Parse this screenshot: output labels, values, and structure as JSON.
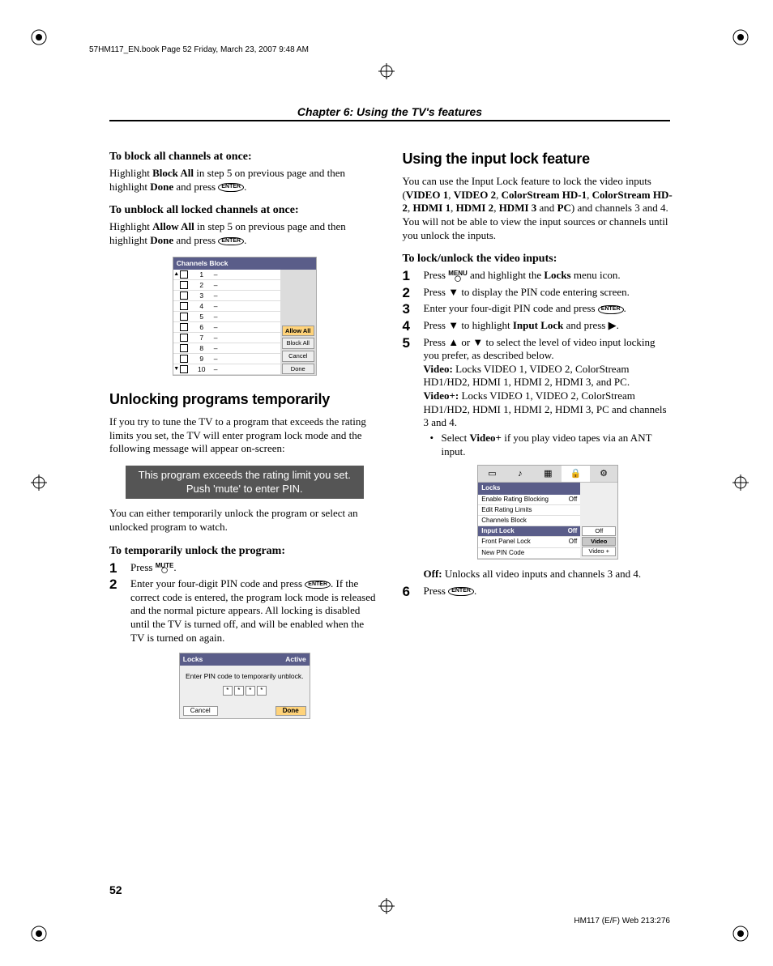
{
  "header_line": "57HM117_EN.book  Page 52  Friday, March 23, 2007  9:48 AM",
  "chapter_title": "Chapter 6: Using the TV's features",
  "page_number": "52",
  "footer_right": "HM117 (E/F) Web 213:276",
  "icons": {
    "enter": "ENTER",
    "menu": "MENU",
    "mute": "MUTE"
  },
  "left": {
    "block_all_h": "To block all channels at once:",
    "block_all_p1a": "Highlight ",
    "block_all_p1b": "Block All",
    "block_all_p1c": " in step 5 on previous page and then highlight ",
    "block_all_p1d": "Done",
    "block_all_p1e": " and press ",
    "block_all_p1f": ".",
    "unblock_h": "To unblock all locked channels at once:",
    "unblock_p1a": "Highlight ",
    "unblock_p1b": "Allow All",
    "unblock_p1c": " in step 5 on previous page and then highlight ",
    "unblock_p1d": "Done",
    "unblock_p1e": " and press ",
    "unblock_p1f": ".",
    "channels_title": "Channels Block",
    "channels_rows": [
      "1",
      "2",
      "3",
      "4",
      "5",
      "6",
      "7",
      "8",
      "9",
      "10"
    ],
    "channels_btns": [
      "Allow All",
      "Block All",
      "Cancel",
      "Done"
    ],
    "sect_unlock": "Unlocking programs temporarily",
    "unlock_intro": "If you try to tune the TV to a program that exceeds the rating limits you set, the TV will enter program lock mode and the following message will appear on-screen:",
    "msg1": "This program exceeds the rating limit you set.",
    "msg2": "Push 'mute' to enter PIN.",
    "unlock_after": "You can either temporarily unlock the program or select an unlocked program to watch.",
    "unlock_steps_h": "To temporarily unlock the program:",
    "step1a": "Press ",
    "step1b": ".",
    "step2a": "Enter your four-digit PIN code and press ",
    "step2b": ". If the correct code is entered, the program lock mode is released and the normal picture appears. All locking is disabled until the TV is turned off, and will be enabled when the TV is turned on again.",
    "locks_pin_title": "Locks",
    "locks_pin_state": "Active",
    "locks_pin_msg": "Enter PIN code to temporarily unblock.",
    "locks_pin_star": "*",
    "locks_pin_cancel": "Cancel",
    "locks_pin_done": "Done"
  },
  "right": {
    "sect_input": "Using the input lock feature",
    "intro_a": "You can use the Input Lock feature to lock the video inputs (",
    "intro_b": "VIDEO 1",
    "intro_c": ", ",
    "intro_d": "VIDEO 2",
    "intro_e": ", ",
    "intro_f": "ColorStream HD-1",
    "intro_g": ", ",
    "intro_h": "ColorStream HD-2",
    "intro_i": ", ",
    "intro_j": "HDMI 1",
    "intro_k": ", ",
    "intro_l": "HDMI 2",
    "intro_m": ", ",
    "intro_n": "HDMI 3",
    "intro_o": " and ",
    "intro_p": "PC",
    "intro_q": ") and channels 3 and 4. You will not be able to view the input sources or channels until you unlock the inputs.",
    "lock_steps_h": "To lock/unlock the video inputs:",
    "s1a": "Press ",
    "s1b": " and highlight the ",
    "s1c": "Locks",
    "s1d": " menu icon.",
    "s2": "Press ▼ to display the PIN code entering screen.",
    "s3a": "Enter your four-digit PIN code and press ",
    "s3b": ".",
    "s4a": "Press ▼ to highlight ",
    "s4b": "Input Lock",
    "s4c": " and press ▶.",
    "s5a": "Press ▲ or ▼ to select the level of video input locking you prefer, as described below.",
    "s5_video_lbl": "Video:",
    "s5_video_txt": " Locks VIDEO 1, VIDEO 2, ColorStream HD1/HD2, HDMI 1, HDMI 2, HDMI 3, and PC.",
    "s5_videop_lbl": "Video+:",
    "s5_videop_txt": " Locks VIDEO 1, VIDEO 2, ColorStream HD1/HD2, HDMI 1, HDMI 2, HDMI 3, PC and channels 3 and 4.",
    "s5_bullet_a": "Select ",
    "s5_bullet_b": "Video+",
    "s5_bullet_c": " if you play video tapes via an ANT input.",
    "locks_menu_title": "Locks",
    "locks_menu_items": [
      {
        "label": "Enable Rating Blocking",
        "val": "Off"
      },
      {
        "label": "Edit Rating Limits",
        "val": ""
      },
      {
        "label": "Channels Block",
        "val": ""
      },
      {
        "label": "Input Lock",
        "val": "Off"
      },
      {
        "label": "Front Panel Lock",
        "val": "Off"
      },
      {
        "label": "New PIN Code",
        "val": ""
      }
    ],
    "locks_menu_opts": [
      "Off",
      "Video",
      "Video +"
    ],
    "off_lbl": "Off:",
    "off_txt": " Unlocks all video inputs and channels 3 and 4.",
    "s6a": "Press ",
    "s6b": "."
  }
}
